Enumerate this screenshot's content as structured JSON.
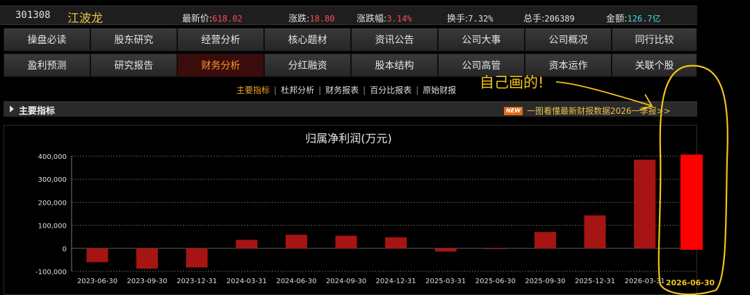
{
  "stock": {
    "code": "301308",
    "name": "江波龙",
    "quotes": [
      {
        "label": "最新价:",
        "value": "618.02",
        "color": "red"
      },
      {
        "label": "涨跌:",
        "value": "18.80",
        "color": "red"
      },
      {
        "label": "涨跌幅:",
        "value": "3.14%",
        "color": "red"
      },
      {
        "label": "换手:",
        "value": "7.32%",
        "color": "plain"
      },
      {
        "label": "总手:",
        "value": "206389",
        "color": "plain"
      },
      {
        "label": "金额:",
        "value": "126.7亿",
        "color": "cyan"
      }
    ]
  },
  "nav": {
    "row1": [
      "操盘必读",
      "股东研究",
      "经营分析",
      "核心题材",
      "资讯公告",
      "公司大事",
      "公司概况",
      "同行比较"
    ],
    "row2": [
      "盈利预测",
      "研究报告",
      "财务分析",
      "分红融资",
      "股本结构",
      "公司高管",
      "资本运作",
      "关联个股"
    ],
    "active": "财务分析"
  },
  "subtabs": {
    "items": [
      "主要指标",
      "杜邦分析",
      "财务报表",
      "百分比报表",
      "原始财报"
    ],
    "active": "主要指标"
  },
  "section": {
    "title": "主要指标",
    "news_badge": "NEW",
    "news_text": "一图看懂最新财报数据2026一季报>>"
  },
  "annotation": {
    "text": "自己画的!",
    "extra_bar_date": "2026-06-30",
    "extra_bar_value": 407000,
    "color": "#f5c518"
  },
  "chart_data": {
    "type": "bar",
    "title": "归属净利润(万元)",
    "categories": [
      "2023-06-30",
      "2023-09-30",
      "2023-12-31",
      "2024-03-31",
      "2024-06-30",
      "2024-09-30",
      "2024-12-31",
      "2025-03-31",
      "2025-06-30",
      "2025-09-30",
      "2025-12-31",
      "2026-03-31"
    ],
    "values": [
      -60000,
      -88000,
      -83000,
      37000,
      59000,
      55000,
      48000,
      -14000,
      -2000,
      71000,
      143000,
      385000
    ],
    "ylim": [
      -100000,
      400000
    ],
    "yticks": [
      "400,000",
      "300,000",
      "200,000",
      "100,000",
      "0",
      "-100,000"
    ],
    "ytick_values": [
      400000,
      300000,
      200000,
      100000,
      0,
      -100000
    ],
    "grid": true,
    "bar_color": "#a61414"
  }
}
